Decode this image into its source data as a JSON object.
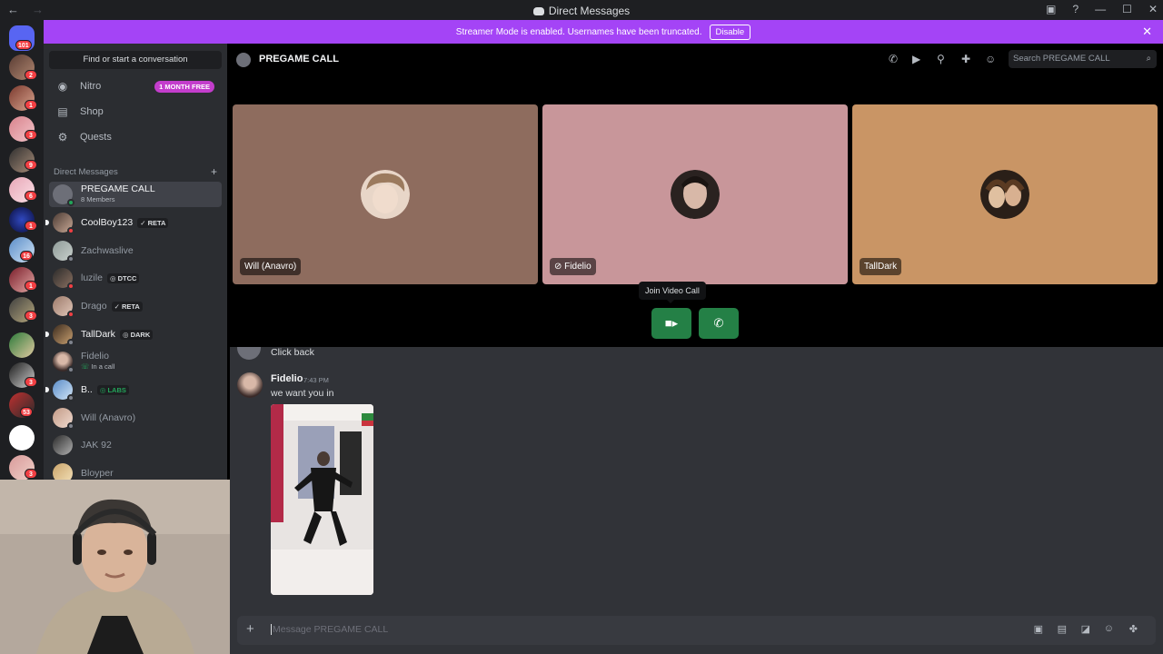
{
  "window": {
    "title": "Direct Messages",
    "nav_back": "←",
    "nav_forward": "→"
  },
  "banner": {
    "text": "Streamer Mode is enabled. Usernames have been truncated.",
    "button": "Disable",
    "close": "✕"
  },
  "rail": {
    "badges": [
      "101",
      "2",
      "1",
      "3",
      "9",
      "6",
      "1",
      "16",
      "1",
      "3",
      "3",
      "53",
      "3"
    ]
  },
  "sidebar": {
    "find_placeholder": "Find or start a conversation",
    "nitro": "Nitro",
    "nitro_badge": "1 MONTH FREE",
    "shop": "Shop",
    "quests": "Quests",
    "dm_header": "Direct Messages",
    "dm_plus": "+",
    "dms": [
      {
        "name": "PREGAME CALL",
        "sub": "8 Members"
      },
      {
        "name": "CoolBoy123",
        "tag": "✓ RETA"
      },
      {
        "name": "Zachwaslive"
      },
      {
        "name": "luzile",
        "tag": "◎ DTCC"
      },
      {
        "name": "Drago",
        "tag": "✓ RETA"
      },
      {
        "name": "TallDark",
        "tag": "◎ DARK"
      },
      {
        "name": "Fidelio",
        "sub": "In a call"
      },
      {
        "name": "B..",
        "tag": "◎ LABS"
      },
      {
        "name": "Will (Anavro)"
      },
      {
        "name": "JAK 92"
      },
      {
        "name": "Bloyper"
      }
    ]
  },
  "header": {
    "channel_name": "PREGAME CALL",
    "search_placeholder": "Search PREGAME CALL"
  },
  "call": {
    "participants": [
      {
        "name": "Will (Anavro)",
        "color": "#8e6c5e"
      },
      {
        "name": "Fidelio",
        "color": "#c8969a"
      },
      {
        "name": "TallDark",
        "color": "#c99565"
      }
    ],
    "tooltip": "Join Video Call"
  },
  "chat": {
    "prev_message": "Click back",
    "author": "Fidelio",
    "time": "7:43 PM",
    "message": "we want you in",
    "composer_placeholder": "Message PREGAME CALL"
  },
  "colors": {
    "banner": "#a444f6",
    "join_green": "#248046",
    "nitro_badge": "#c33dcc"
  }
}
